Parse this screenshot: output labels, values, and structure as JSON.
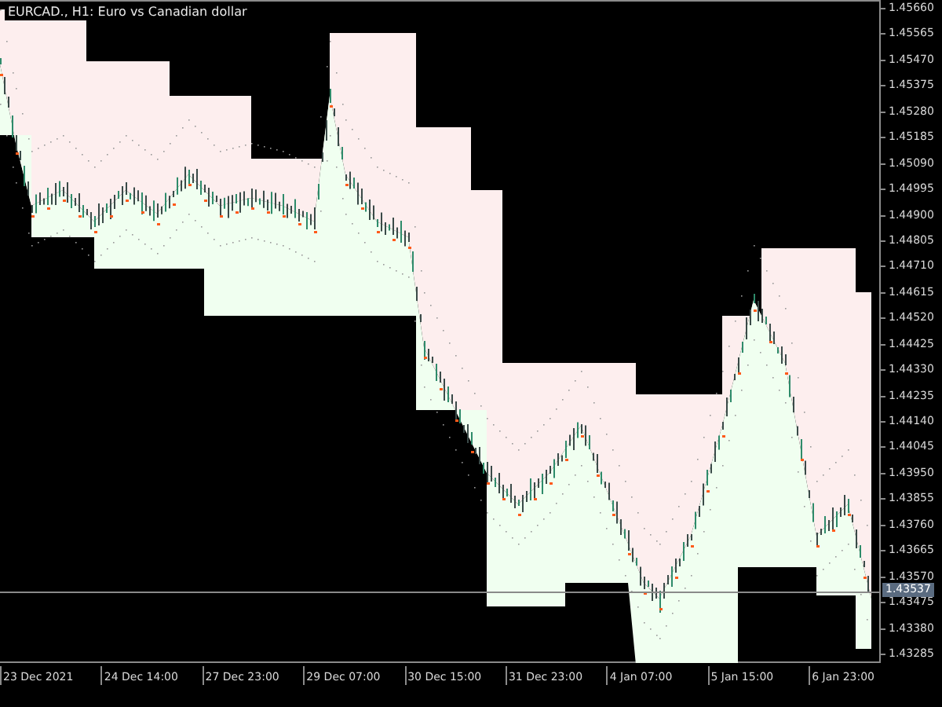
{
  "chart_title": "EURCAD., H1:  Euro vs Canadian dollar",
  "price_axis": [
    "1.45660",
    "1.45565",
    "1.45470",
    "1.45375",
    "1.45280",
    "1.45185",
    "1.45090",
    "1.44995",
    "1.44900",
    "1.44805",
    "1.44710",
    "1.44615",
    "1.44520",
    "1.44425",
    "1.44330",
    "1.44235",
    "1.44140",
    "1.44045",
    "1.43950",
    "1.43855",
    "1.43760",
    "1.43665",
    "1.43570",
    "1.43475",
    "1.43380",
    "1.43285"
  ],
  "current_price": "1.43537",
  "time_axis": [
    "23 Dec 2021",
    "24 Dec 14:00",
    "27 Dec 23:00",
    "29 Dec 07:00",
    "30 Dec 15:00",
    "31 Dec 23:00",
    "4 Jan 07:00",
    "5 Jan 15:00",
    "6 Jan 23:00"
  ]
}
